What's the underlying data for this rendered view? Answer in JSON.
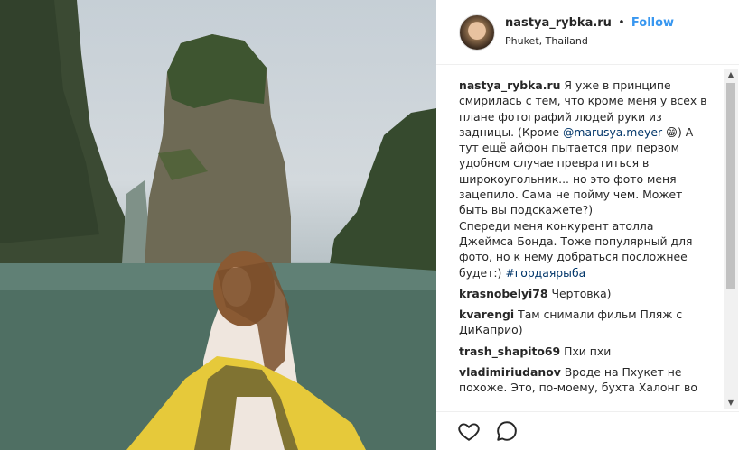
{
  "post": {
    "username": "nastya_rybka.ru",
    "separator": "•",
    "follow_label": "Follow",
    "location": "Phuket, Thailand"
  },
  "caption": {
    "user": "nastya_rybka.ru",
    "text_1": "Я уже в принципе смирилась с тем, что кроме меня у всех в плане фотографий людей руки из задницы. (Кроме ",
    "mention": "@marusya.meyer",
    "emoji": "😁",
    "text_2": ") А тут ещё айфон пытается при первом удобном случае превратиться в широкоугольник... но это фото меня зацепило. Сама не пойму чем. Может быть вы подскажете?)",
    "text_3": "Спереди меня конкурент атолла Джеймса Бонда. Тоже популярный для фото, но к нему добраться посложнее будет:) ",
    "hashtag": "#гордаярыба"
  },
  "comments": [
    {
      "user": "krasnobelyi78",
      "text": "Чертовка)"
    },
    {
      "user": "kvarengi",
      "text": "Там снимали фильм Пляж с ДиКаприо)"
    },
    {
      "user": "trash_shapito69",
      "text": "Пхи пхи"
    },
    {
      "user": "vladimiriudanov",
      "text": "Вроде на Пхукет не похоже. Это, по-моему, бухта Халонг во"
    }
  ],
  "icons": {
    "like": "heart-outline-icon",
    "comment": "speech-bubble-icon",
    "scroll_up": "▲",
    "scroll_down": "▼"
  },
  "colors": {
    "link": "#003569",
    "follow": "#3897f0",
    "kayak": "#e6c93a"
  }
}
